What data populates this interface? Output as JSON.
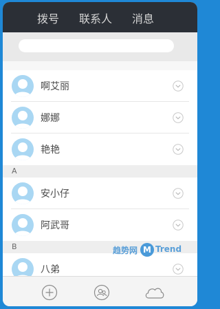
{
  "header": {
    "tabs": [
      {
        "label": "拨号"
      },
      {
        "label": "联系人"
      },
      {
        "label": "消息"
      }
    ]
  },
  "search": {
    "value": "",
    "placeholder": ""
  },
  "contacts": [
    {
      "name": "啊艾丽"
    },
    {
      "name": "娜娜"
    },
    {
      "name": "艳艳"
    },
    {
      "name": "安小仔"
    },
    {
      "name": "阿武哥"
    },
    {
      "name": "八弟"
    }
  ],
  "sections": [
    {
      "letter": "A"
    },
    {
      "letter": "B"
    }
  ],
  "watermark": {
    "text_left": "趋势网",
    "badge": "M",
    "text_right": "Trend"
  },
  "colors": {
    "accent": "#1f88d6",
    "avatar": "#a9d7f3",
    "topbar": "#2b2f36"
  },
  "icons": {
    "bottom": [
      "plus-circle-icon",
      "contacts-icon",
      "cloud-icon"
    ],
    "row": "chevron-down-icon"
  }
}
